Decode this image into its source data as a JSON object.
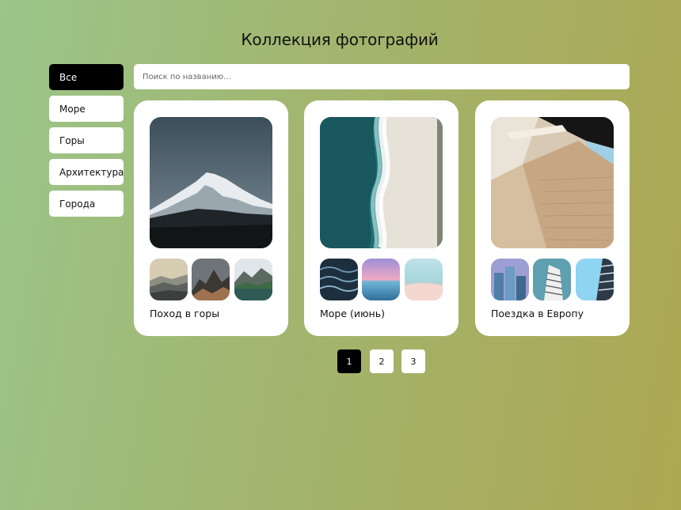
{
  "page": {
    "title": "Коллекция фотографий"
  },
  "sidebar": {
    "categories": [
      {
        "label": "Все",
        "active": true
      },
      {
        "label": "Море",
        "active": false
      },
      {
        "label": "Горы",
        "active": false
      },
      {
        "label": "Архитектура",
        "active": false
      },
      {
        "label": "Города",
        "active": false
      }
    ]
  },
  "search": {
    "placeholder": "Поиск по названию...",
    "value": ""
  },
  "collections": [
    {
      "title": "Поход в горы",
      "cover": "snowy-mountain-photo",
      "thumbnails": [
        "misty-hills-photo",
        "rocky-peaks-photo",
        "mountain-lake-photo"
      ]
    },
    {
      "title": "Море (июнь)",
      "cover": "aerial-beach-waves-photo",
      "thumbnails": [
        "dark-sea-waves-photo",
        "pink-sunset-sea-photo",
        "pastel-beach-photo"
      ]
    },
    {
      "title": "Поездка в Европу",
      "cover": "modern-architecture-photo",
      "thumbnails": [
        "city-towers-photo",
        "spiral-building-photo",
        "blue-sky-balconies-photo"
      ]
    }
  ],
  "pagination": {
    "pages": [
      "1",
      "2",
      "3"
    ],
    "current": "1"
  },
  "colors": {
    "accent": "#000000",
    "background_start": "#9bc58a",
    "background_end": "#aca752",
    "card": "#ffffff"
  }
}
